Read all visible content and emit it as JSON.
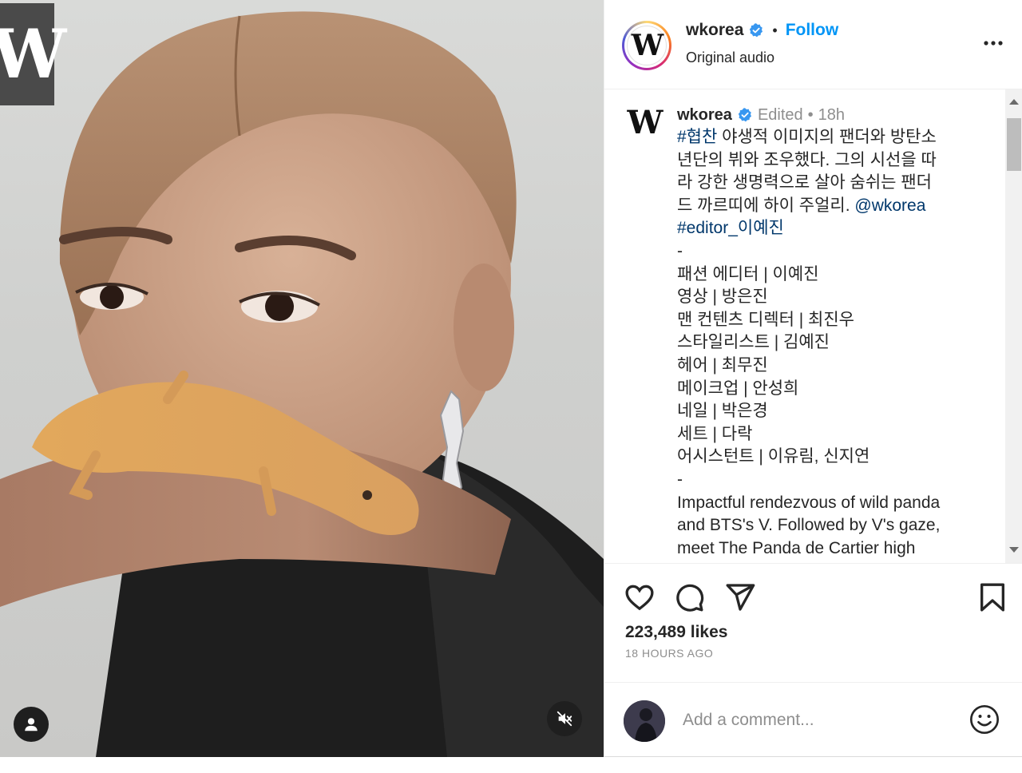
{
  "media": {
    "brand_letter": "W"
  },
  "header": {
    "username": "wkorea",
    "separator": "•",
    "follow_label": "Follow",
    "audio_label": "Original audio"
  },
  "caption": {
    "username": "wkorea",
    "edited_label": "Edited",
    "separator": "•",
    "time_ago": "18h",
    "hashtag": "#협찬",
    "line1_rest": " 야생적 이미지의 팬더와 방탄소",
    "line2": "년단의 뷔와 조우했다. 그의 시선을 따",
    "line3": "라 강한 생명력으로 살아 숨쉬는 팬더",
    "line4_text": "드 까르띠에 하이 주얼리. ",
    "mention": "@wkorea",
    "editor_tag": "#editor_이예진",
    "dash1": "-",
    "credits": [
      "패션 에디터 | 이예진",
      "영상 | 방은진",
      "맨 컨텐츠 디렉터 | 최진우",
      "스타일리스트 | 김예진",
      "헤어 | 최무진",
      "메이크업 | 안성희",
      "네일 | 박은경",
      "세트 | 다락",
      "어시스턴트 | 이유림, 신지연"
    ],
    "dash2": "-",
    "english_lines": [
      "Impactful rendezvous of wild panda",
      "and BTS's V. Followed by V's gaze,",
      "meet The Panda de Cartier high"
    ]
  },
  "engagement": {
    "likes": "223,489 likes",
    "time_ago": "18 HOURS AGO"
  },
  "comment_box": {
    "placeholder": "Add a comment..."
  },
  "colors": {
    "accent": "#0095f6",
    "link": "#00376b",
    "verified": "#3897f0",
    "muted": "#8e8e8e"
  },
  "icons": {
    "verified": "verified-badge-icon",
    "more": "more-options-icon",
    "like": "heart-icon",
    "comment": "comment-bubble-icon",
    "share": "paper-plane-icon",
    "save": "bookmark-icon",
    "emoji": "smiley-icon",
    "user": "user-icon",
    "mute": "speaker-muted-icon"
  }
}
